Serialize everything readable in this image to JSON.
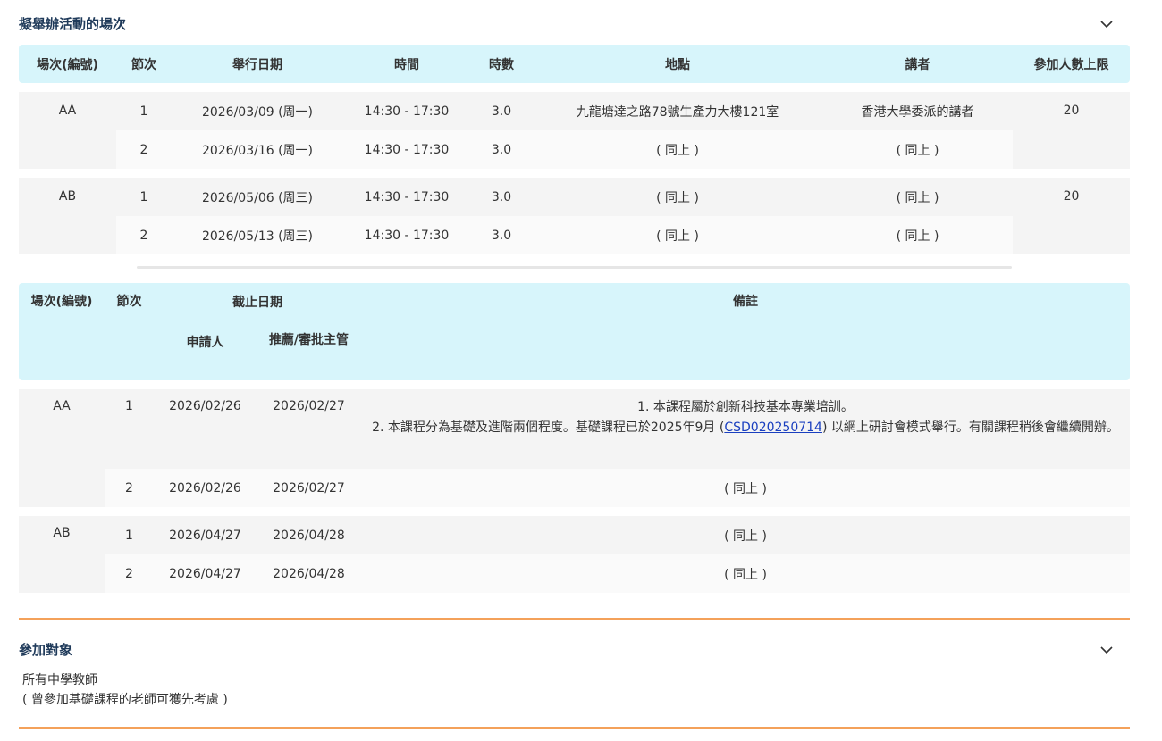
{
  "sessions_section": {
    "title": "擬舉辦活動的場次"
  },
  "schedule": {
    "headers": [
      "場次(編號)",
      "節次",
      "舉行日期",
      "時間",
      "時數",
      "地點",
      "講者",
      "參加人數上限"
    ],
    "groups": [
      {
        "code": "AA",
        "limit": "20",
        "rows": [
          {
            "seq": "1",
            "date": "2026/03/09 (周一)",
            "time": "14:30 - 17:30",
            "hours": "3.0",
            "venue": "九龍塘達之路78號生產力大樓121室",
            "speaker": "香港大學委派的講者"
          },
          {
            "seq": "2",
            "date": "2026/03/16 (周一)",
            "time": "14:30 - 17:30",
            "hours": "3.0",
            "venue": "( 同上 )",
            "speaker": "( 同上 )"
          }
        ]
      },
      {
        "code": "AB",
        "limit": "20",
        "rows": [
          {
            "seq": "1",
            "date": "2026/05/06 (周三)",
            "time": "14:30 - 17:30",
            "hours": "3.0",
            "venue": "( 同上 )",
            "speaker": "( 同上 )"
          },
          {
            "seq": "2",
            "date": "2026/05/13 (周三)",
            "time": "14:30 - 17:30",
            "hours": "3.0",
            "venue": "( 同上 )",
            "speaker": "( 同上 )"
          }
        ]
      }
    ]
  },
  "deadline": {
    "headers": {
      "code": "場次(編號)",
      "seq": "節次",
      "deadline": "截止日期",
      "applicant": "申請人",
      "approver": "推薦/審批主管",
      "remarks": "備註"
    },
    "groups": [
      {
        "code": "AA",
        "rows": [
          {
            "seq": "1",
            "applicant": "2026/02/26",
            "approver": "2026/02/27",
            "remark_line1": "1. 本課程屬於創新科技基本專業培訓。",
            "remark_line2_before": "2. 本課程分為基礎及進階兩個程度。基礎課程已於2025年9月 (",
            "remark_link": "CSD020250714",
            "remark_line2_after": ") 以網上研討會模式舉行。有關課程稍後會繼續開辦。"
          },
          {
            "seq": "2",
            "applicant": "2026/02/26",
            "approver": "2026/02/27",
            "remark": "( 同上 )"
          }
        ]
      },
      {
        "code": "AB",
        "rows": [
          {
            "seq": "1",
            "applicant": "2026/04/27",
            "approver": "2026/04/28",
            "remark": "( 同上 )"
          },
          {
            "seq": "2",
            "applicant": "2026/04/27",
            "approver": "2026/04/28",
            "remark": "( 同上 )"
          }
        ]
      }
    ]
  },
  "target_section": {
    "title": "參加對象",
    "line1": "所有中學教師",
    "line2": "( 曾參加基礎課程的老師可獲先考慮 )"
  },
  "icons": {
    "collapse": "chevron-down-icon"
  },
  "colors": {
    "header_bg": "#d7f5fb",
    "accent": "#f4a15a",
    "title": "#1f3a5a",
    "link": "#1a3fbf"
  }
}
